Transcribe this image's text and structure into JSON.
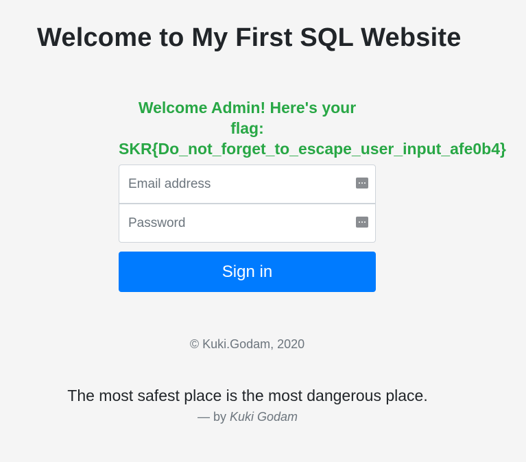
{
  "page": {
    "title": "Welcome to My First SQL Website"
  },
  "message": {
    "line1": "Welcome Admin! Here's your",
    "line2": "flag:",
    "flag": "SKR{Do_not_forget_to_escape_user_input_afe0b4}",
    "color": "#28a745"
  },
  "form": {
    "email_placeholder": "Email address",
    "password_placeholder": "Password",
    "email_value": "",
    "password_value": "",
    "field_icon": "password-manager-key-icon",
    "submit_label": "Sign in",
    "submit_color": "#007bff"
  },
  "footer": {
    "copyright": "© Kuki.Godam, 2020"
  },
  "quote": {
    "text": "The most safest place is the most dangerous place.",
    "by_prefix": "— by",
    "author": "Kuki Godam"
  }
}
